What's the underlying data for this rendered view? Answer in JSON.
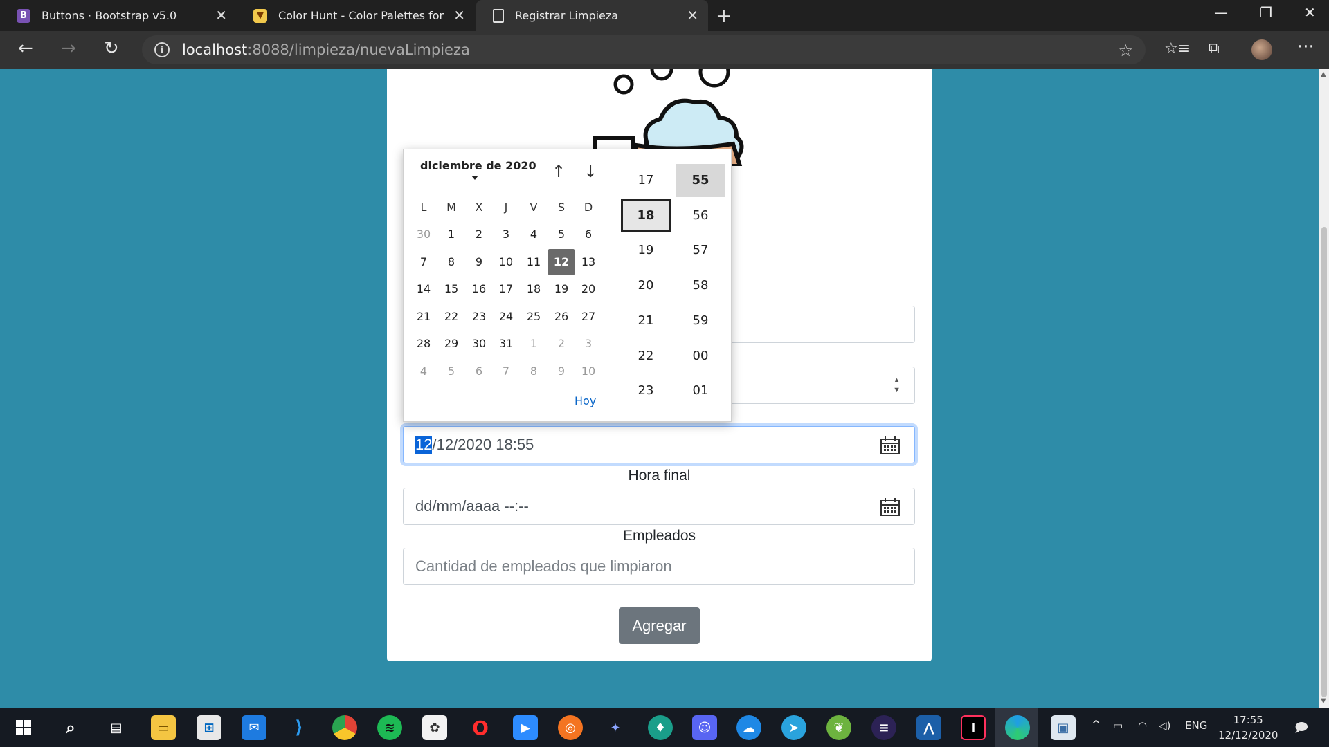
{
  "tabs": [
    {
      "title": "Buttons · Bootstrap v5.0",
      "favicon": "B"
    },
    {
      "title": "Color Hunt - Color Palettes for D",
      "favicon": "paint-icon"
    },
    {
      "title": "Registrar Limpieza",
      "favicon": "page-icon"
    }
  ],
  "address": {
    "host": "localhost",
    "path": ":8088/limpieza/nuevaLimpieza"
  },
  "picker": {
    "month_label": "diciembre de 2020",
    "weekdays": [
      "L",
      "M",
      "X",
      "J",
      "V",
      "S",
      "D"
    ],
    "weeks": [
      [
        "30",
        "1",
        "2",
        "3",
        "4",
        "5",
        "6"
      ],
      [
        "7",
        "8",
        "9",
        "10",
        "11",
        "12",
        "13"
      ],
      [
        "14",
        "15",
        "16",
        "17",
        "18",
        "19",
        "20"
      ],
      [
        "21",
        "22",
        "23",
        "24",
        "25",
        "26",
        "27"
      ],
      [
        "28",
        "29",
        "30",
        "31",
        "1",
        "2",
        "3"
      ],
      [
        "4",
        "5",
        "6",
        "7",
        "8",
        "9",
        "10"
      ]
    ],
    "selected_day": "12",
    "today_label": "Hoy",
    "hours": [
      "17",
      "18",
      "19",
      "20",
      "21",
      "22",
      "23"
    ],
    "selected_hour": "18",
    "minutes": [
      "55",
      "56",
      "57",
      "58",
      "59",
      "00",
      "01"
    ],
    "selected_minute": "55"
  },
  "form": {
    "start_value_selected": "12",
    "start_value_rest": "/12/2020 18:55",
    "end_label": "Hora final",
    "end_placeholder": "dd/mm/aaaa --:--",
    "employees_label": "Empleados",
    "employees_placeholder": "Cantidad de empleados que limpiaron",
    "submit_label": "Agregar"
  },
  "tray": {
    "lang": "ENG",
    "time": "17:55",
    "date": "12/12/2020"
  },
  "colors": {
    "page_bg": "#2e8ca8",
    "button_bg": "#6c757d",
    "focus_border": "#86b7fe",
    "selection": "#0a64d8"
  }
}
